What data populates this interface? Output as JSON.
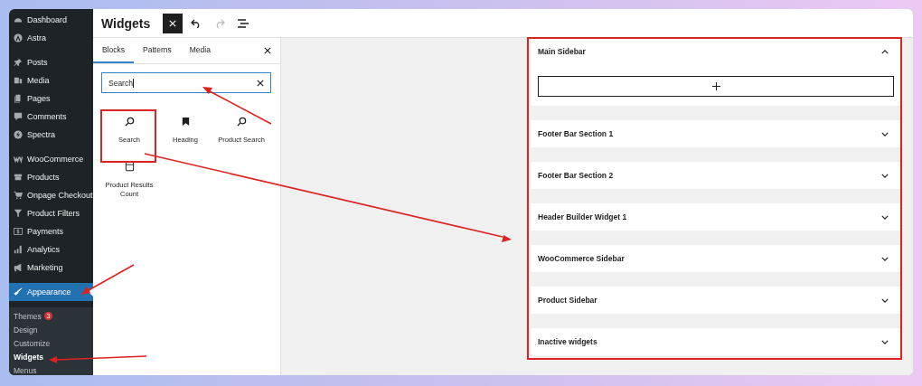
{
  "sidebar": {
    "groups": [
      [
        {
          "label": "Dashboard",
          "selected": false
        },
        {
          "label": "Astra",
          "selected": false
        }
      ],
      [
        {
          "label": "Posts",
          "selected": false
        },
        {
          "label": "Media",
          "selected": false
        },
        {
          "label": "Pages",
          "selected": false
        },
        {
          "label": "Comments",
          "selected": false
        },
        {
          "label": "Spectra",
          "selected": false
        }
      ],
      [
        {
          "label": "WooCommerce",
          "selected": false
        },
        {
          "label": "Products",
          "selected": false
        },
        {
          "label": "Onpage Checkout",
          "selected": false
        },
        {
          "label": "Product Filters",
          "selected": false
        },
        {
          "label": "Payments",
          "selected": false
        },
        {
          "label": "Analytics",
          "selected": false
        },
        {
          "label": "Marketing",
          "selected": false
        }
      ],
      [
        {
          "label": "Appearance",
          "selected": true
        }
      ]
    ],
    "submenu": [
      {
        "label": "Themes",
        "badge": "3",
        "selected": false
      },
      {
        "label": "Design",
        "selected": false
      },
      {
        "label": "Customize",
        "selected": false
      },
      {
        "label": "Widgets",
        "selected": true
      },
      {
        "label": "Menus",
        "selected": false
      }
    ]
  },
  "window": {
    "title": "Widgets"
  },
  "toolbar": [
    {
      "kind": "close"
    },
    {
      "kind": "undo",
      "disabled": false
    },
    {
      "kind": "redo",
      "disabled": true
    },
    {
      "kind": "list-view"
    }
  ],
  "inserter": {
    "tabs": [
      {
        "label": "Blocks",
        "selected": true
      },
      {
        "label": "Patterns",
        "selected": false
      },
      {
        "label": "Media",
        "selected": false
      }
    ],
    "search": {
      "value": "Search"
    },
    "blocks": [
      {
        "label": "Search"
      },
      {
        "label": "Heading"
      },
      {
        "label": "Product Search"
      },
      {
        "label": "Product Results Count"
      }
    ]
  },
  "widget_areas": [
    {
      "title": "Main Sidebar",
      "expanded": true
    },
    {
      "title": "Footer Bar Section 1",
      "expanded": false
    },
    {
      "title": "Footer Bar Section 2",
      "expanded": false
    },
    {
      "title": "Header Builder Widget 1",
      "expanded": false
    },
    {
      "title": "WooCommerce Sidebar",
      "expanded": false
    },
    {
      "title": "Product Sidebar",
      "expanded": false
    },
    {
      "title": "Inactive widgets",
      "expanded": false
    }
  ]
}
